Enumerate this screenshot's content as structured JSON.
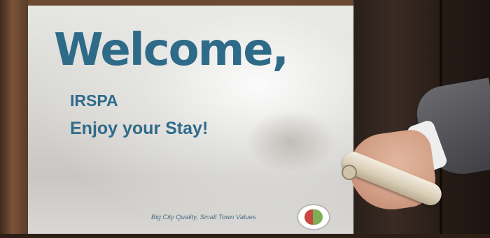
{
  "sign": {
    "headline": "Welcome,",
    "guest_name": "IRSPA",
    "greeting": "Enjoy your Stay!",
    "tagline": "Big City Quality, Small Town Values"
  },
  "colors": {
    "headline_text": "#2e6b88",
    "screen_background": "#e0e0de",
    "logo_red": "#c8493f",
    "logo_green": "#7fae55"
  },
  "icons": {
    "hotel_logo": "hotel-logo-icon"
  }
}
